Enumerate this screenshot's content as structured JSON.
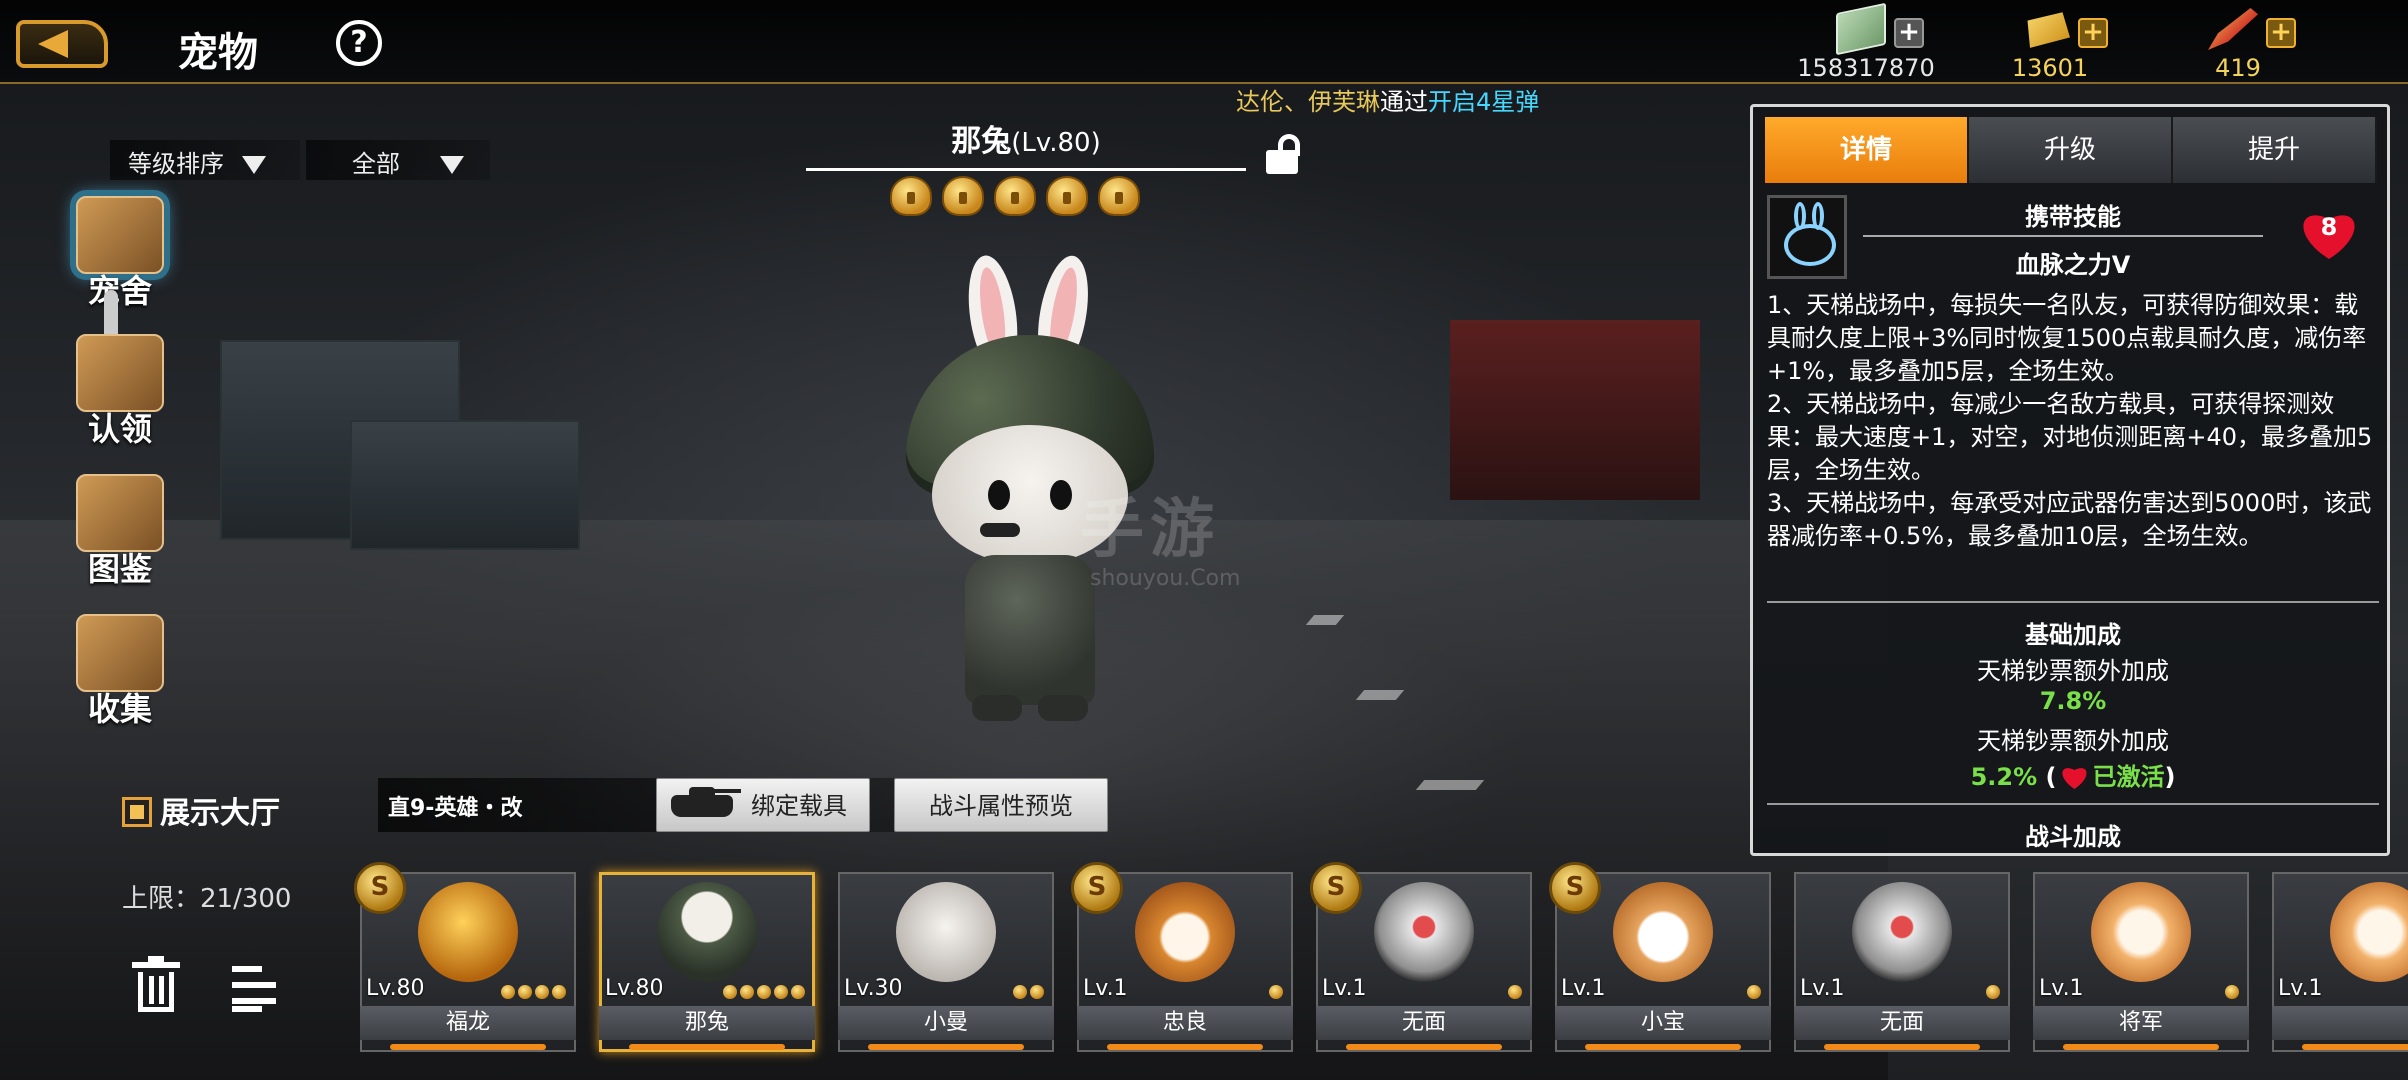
{
  "header": {
    "title": "宠物",
    "help_icon": "question-circle-icon",
    "currencies": [
      {
        "icon": "cash-stack-icon",
        "value": "158317870",
        "plus": "+"
      },
      {
        "icon": "gold-bar-icon",
        "value": "13601",
        "plus": "+"
      },
      {
        "icon": "rocket-icon",
        "value": "419",
        "plus": "+"
      }
    ]
  },
  "marquee": {
    "names": "达伦、伊芙琳",
    "via": "通过",
    "event": "开启4星弹"
  },
  "filters": {
    "sort": "等级排序",
    "category": "全部"
  },
  "nav": [
    {
      "label": "宠舍",
      "icon": "kennel-icon",
      "active": true
    },
    {
      "label": "认领",
      "icon": "adopt-crate-icon",
      "active": false
    },
    {
      "label": "图鉴",
      "icon": "handbook-icon",
      "active": false
    },
    {
      "label": "收集",
      "icon": "collection-box-icon",
      "active": false
    }
  ],
  "pet": {
    "name": "那兔",
    "level": "(Lv.80)",
    "stars": 5
  },
  "watermark": {
    "main": "手游",
    "sub": "shouyou.Com"
  },
  "show_hall": "展示大厅",
  "limit": "上限：21/300",
  "vehicle": {
    "name": "直9-英雄・改",
    "bind_label": "绑定载具",
    "preview_label": "战斗属性预览"
  },
  "detail": {
    "tabs": [
      "详情",
      "升级",
      "提升"
    ],
    "active_tab": 0,
    "skill_header": "携带技能",
    "skill_name": "血脉之力Ⅴ",
    "heart_count": "8",
    "skill_desc": [
      "1、天梯战场中，每损失一名队友，可获得防御效果：载具耐久度上限+3%同时恢复1500点载具耐久度，减伤率+1%，最多叠加5层，全场生效。",
      "2、天梯战场中，每减少一名敌方载具，可获得探测效果：最大速度+1，对空，对地侦测距离+40，最多叠加5层，全场生效。",
      "3、天梯战场中，每承受对应武器伤害达到5000时，该武器减伤率+0.5%，最多叠加10层，全场生效。"
    ],
    "base_title": "基础加成",
    "stats": [
      {
        "label": "天梯钞票额外加成",
        "value": "7.8%"
      },
      {
        "label": "天梯钞票额外加成",
        "value": "5.2%",
        "activated": "已激活"
      }
    ],
    "battle_title": "战斗加成"
  },
  "cards": [
    {
      "name": "福龙",
      "level": "Lv.80",
      "bells": 4,
      "coin": true,
      "portrait": "dragon",
      "selected": false
    },
    {
      "name": "那兔",
      "level": "Lv.80",
      "bells": 5,
      "coin": false,
      "portrait": "bunny",
      "selected": true
    },
    {
      "name": "小曼",
      "level": "Lv.30",
      "bells": 2,
      "coin": false,
      "portrait": "cat1",
      "selected": false
    },
    {
      "name": "忠良",
      "level": "Lv.1",
      "bells": 1,
      "coin": true,
      "portrait": "shiba",
      "selected": false
    },
    {
      "name": "无面",
      "level": "Lv.1",
      "bells": 1,
      "coin": true,
      "portrait": "mask",
      "selected": false
    },
    {
      "name": "小宝",
      "level": "Lv.1",
      "bells": 1,
      "coin": true,
      "portrait": "corgi",
      "selected": false
    },
    {
      "name": "无面",
      "level": "Lv.1",
      "bells": 1,
      "coin": false,
      "portrait": "mask",
      "selected": false
    },
    {
      "name": "将军",
      "level": "Lv.1",
      "bells": 1,
      "coin": false,
      "portrait": "cat2",
      "selected": false
    },
    {
      "name": "",
      "level": "Lv.1",
      "bells": 0,
      "coin": false,
      "portrait": "cat2",
      "selected": false
    }
  ],
  "colors": {
    "accent_orange": "#f28a1a",
    "tab_active": "#ffaa2b",
    "stat_green": "#7ae04a",
    "marquee_gold": "#e8c85a",
    "marquee_cyan": "#46d7ff"
  }
}
